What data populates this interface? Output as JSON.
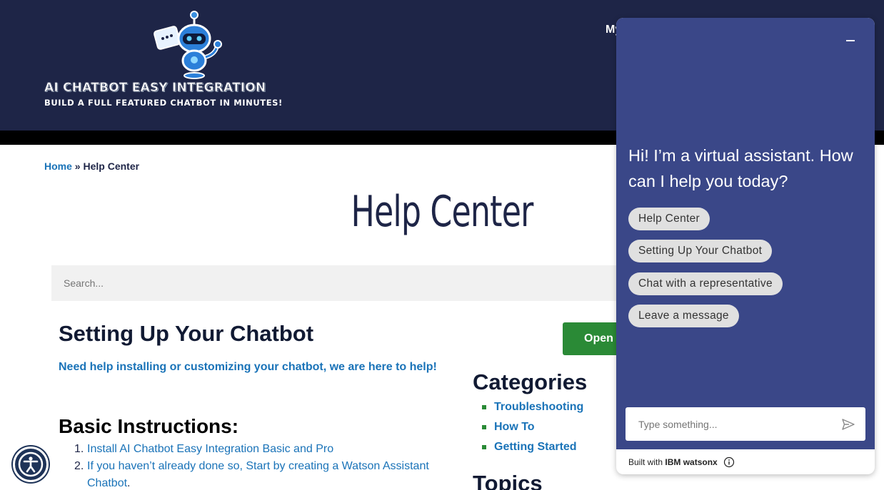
{
  "header": {
    "logo_title": "AI CHATBOT EASY INTEGRATION",
    "logo_tagline": "BUILD A FULL FEATURED CHATBOT IN MINUTES!",
    "nav_partial": "My"
  },
  "breadcrumb": {
    "home": "Home",
    "separator": "»",
    "current": "Help Center"
  },
  "page_title": "Help Center",
  "search": {
    "placeholder": "Search..."
  },
  "content": {
    "section_title": "Setting Up Your Chatbot",
    "intro": "Need help installing or customizing your chatbot, we are here to help!",
    "basic_title": "Basic Instructions:",
    "steps": [
      {
        "num": "1.",
        "text": "Install AI Chatbot Easy Integration Basic and Pro",
        "tail": ""
      },
      {
        "num": "2.",
        "text": "If you haven’t already done so, Start by creating a Watson Assistant Chatbot",
        "tail": "."
      }
    ],
    "open_button": "Open a"
  },
  "sidebar": {
    "categories_title": "Categories",
    "categories": [
      "Troubleshooting",
      "How To",
      "Getting Started"
    ],
    "topics_title": "Topics"
  },
  "chat": {
    "greeting": "Hi! I’m a virtual assistant. How can I help you today?",
    "options": [
      "Help Center",
      "Setting Up Your Chatbot",
      "Chat with a representative",
      "Leave a message"
    ],
    "input_placeholder": "Type something...",
    "footer_prefix": "Built with ",
    "footer_brand": "IBM watsonx"
  },
  "colors": {
    "header_bg": "#1e2547",
    "chat_bg": "#3a4788",
    "link": "#1a73b8",
    "button_green": "#2a8a36"
  }
}
